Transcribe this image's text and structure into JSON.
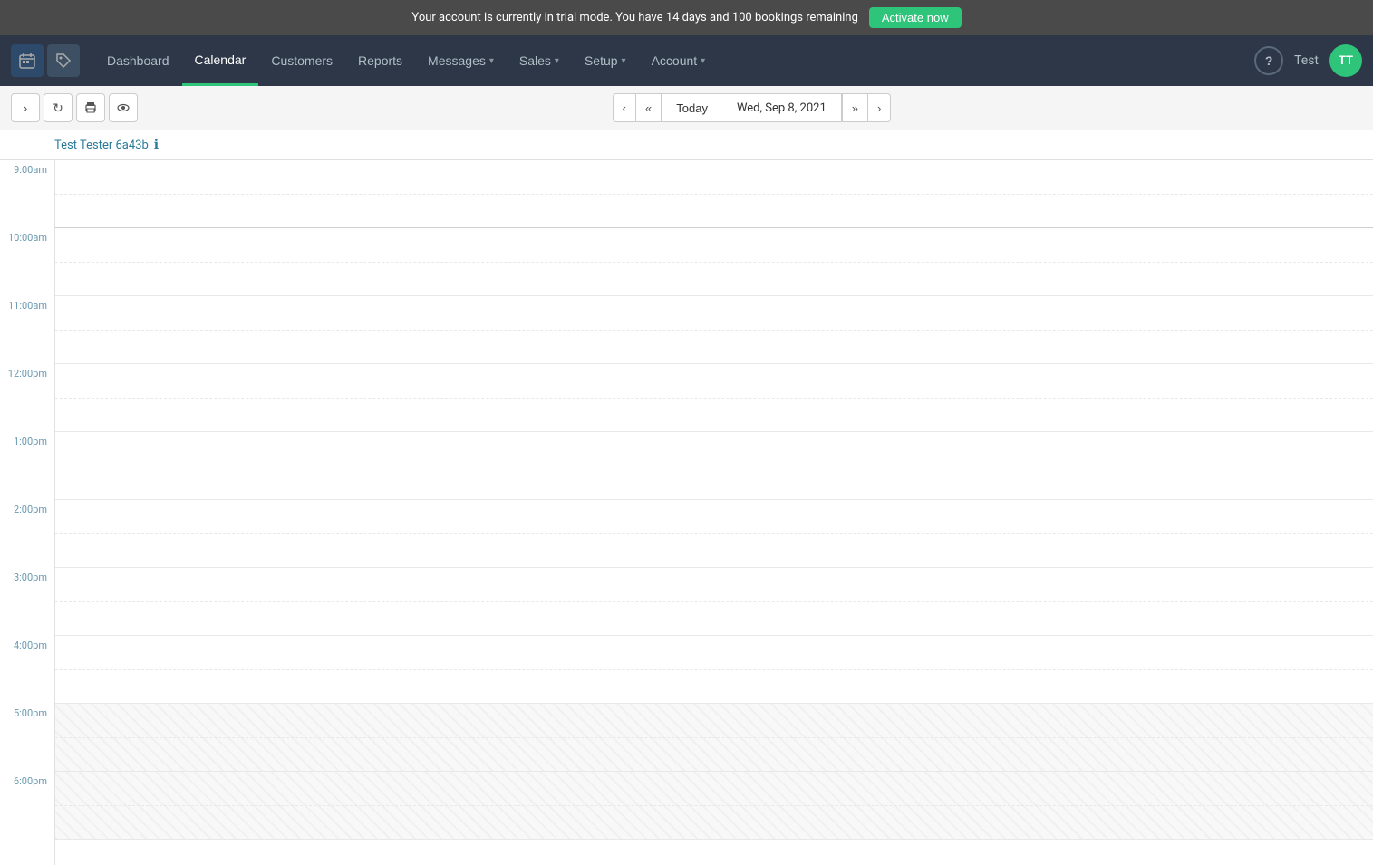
{
  "trial_banner": {
    "message": "Your account is currently in trial mode. You have 14 days and 100 bookings remaining",
    "activate_label": "Activate now"
  },
  "nav": {
    "dashboard_label": "Dashboard",
    "calendar_label": "Calendar",
    "customers_label": "Customers",
    "reports_label": "Reports",
    "messages_label": "Messages",
    "sales_label": "Sales",
    "setup_label": "Setup",
    "account_label": "Account",
    "user_name": "Test",
    "avatar_initials": "TT"
  },
  "toolbar": {
    "arrow_icon": "›",
    "refresh_icon": "↻",
    "print_icon": "🖨",
    "eye_icon": "👁",
    "prev_prev_icon": "«",
    "prev_icon": "‹",
    "today_label": "Today",
    "date_display": "Wed, Sep 8, 2021",
    "next_next_icon": "»",
    "next_icon": "›"
  },
  "calendar": {
    "resource_name": "Test Tester 6a43b",
    "time_slots": [
      {
        "label": "9:00am",
        "shaded": false
      },
      {
        "label": "10:00am",
        "shaded": false
      },
      {
        "label": "11:00am",
        "shaded": false
      },
      {
        "label": "12:00pm",
        "shaded": false
      },
      {
        "label": "1:00pm",
        "shaded": false
      },
      {
        "label": "2:00pm",
        "shaded": false
      },
      {
        "label": "3:00pm",
        "shaded": false
      },
      {
        "label": "4:00pm",
        "shaded": false
      },
      {
        "label": "5:00pm",
        "shaded": true
      },
      {
        "label": "6:00pm",
        "shaded": true
      }
    ]
  }
}
